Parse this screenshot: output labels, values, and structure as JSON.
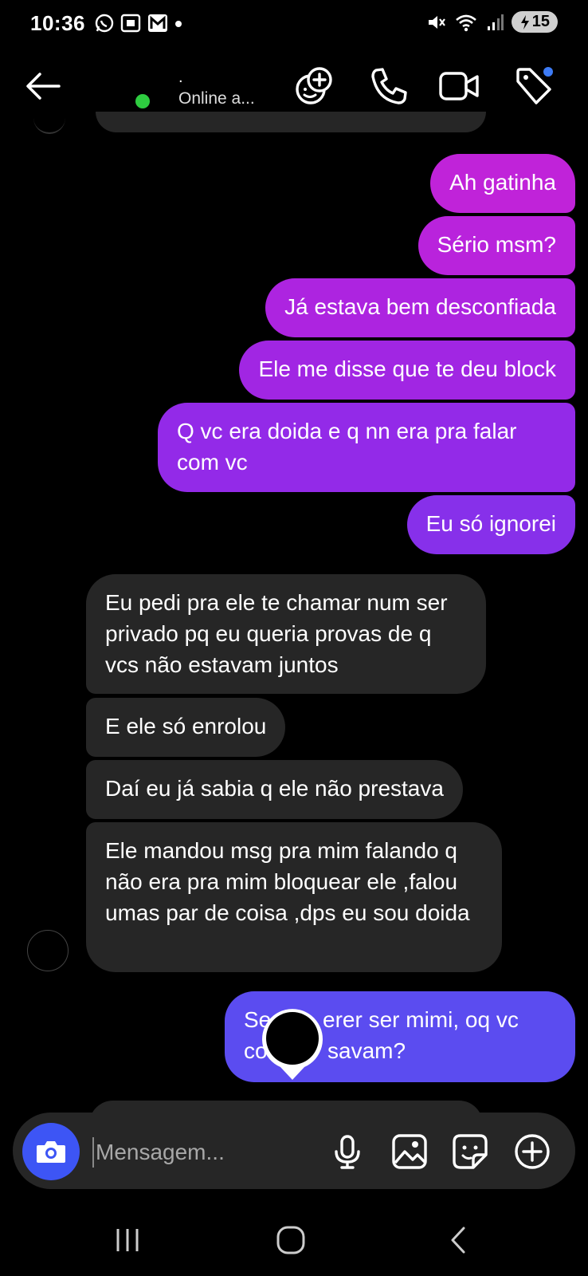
{
  "status_bar": {
    "time": "10:36",
    "battery": "15"
  },
  "header": {
    "contact_name": ".",
    "presence": "Online a..."
  },
  "messages": [
    {
      "side": "sent",
      "text": "Ah gatinha",
      "color": "#c023d9"
    },
    {
      "side": "sent",
      "text": "Sério msm?",
      "color": "#b923dc"
    },
    {
      "side": "sent",
      "text": "Já estava bem desconfiada",
      "color": "#ad24e0"
    },
    {
      "side": "sent",
      "text": "Ele me disse que te deu block",
      "color": "#a126e3"
    },
    {
      "side": "sent",
      "text": "Q vc era doida e q nn era pra falar com vc",
      "color": "#932ae8"
    },
    {
      "side": "sent",
      "text": "Eu só ignorei",
      "color": "#8730ea"
    },
    {
      "side": "received",
      "text": "Eu pedi pra ele te chamar num ser privado pq eu queria provas de q vcs não estavam juntos"
    },
    {
      "side": "received",
      "text": "E ele só enrolou"
    },
    {
      "side": "received",
      "text": "Daí eu já sabia q ele não prestava"
    },
    {
      "side": "received",
      "text": "Ele mandou msg pra mim falando q não era pra mim bloquear ele ,falou umas par de coisa ,dps eu sou doida"
    },
    {
      "side": "sent",
      "text": "Sem querer ser mimi, oq vc conversavam?",
      "visible_text": [
        "Se",
        "erer ser mimi, oq vc",
        "co",
        "savam?"
      ],
      "color": "#5b4cf0"
    }
  ],
  "composer": {
    "placeholder": "Mensagem..."
  },
  "colors": {
    "background": "#000000",
    "received_bubble": "#262626",
    "camera_button": "#3d55f5",
    "online_dot": "#2ecc40",
    "notification_dot": "#3d7bf5"
  },
  "icons": {
    "header": [
      "back-arrow-icon",
      "add-effect-icon",
      "phone-icon",
      "video-camera-icon",
      "tag-icon"
    ],
    "composer": [
      "camera-icon",
      "microphone-icon",
      "gallery-icon",
      "sticker-icon",
      "plus-circle-icon"
    ],
    "nav": [
      "recent-apps-icon",
      "home-icon",
      "back-nav-icon"
    ]
  }
}
